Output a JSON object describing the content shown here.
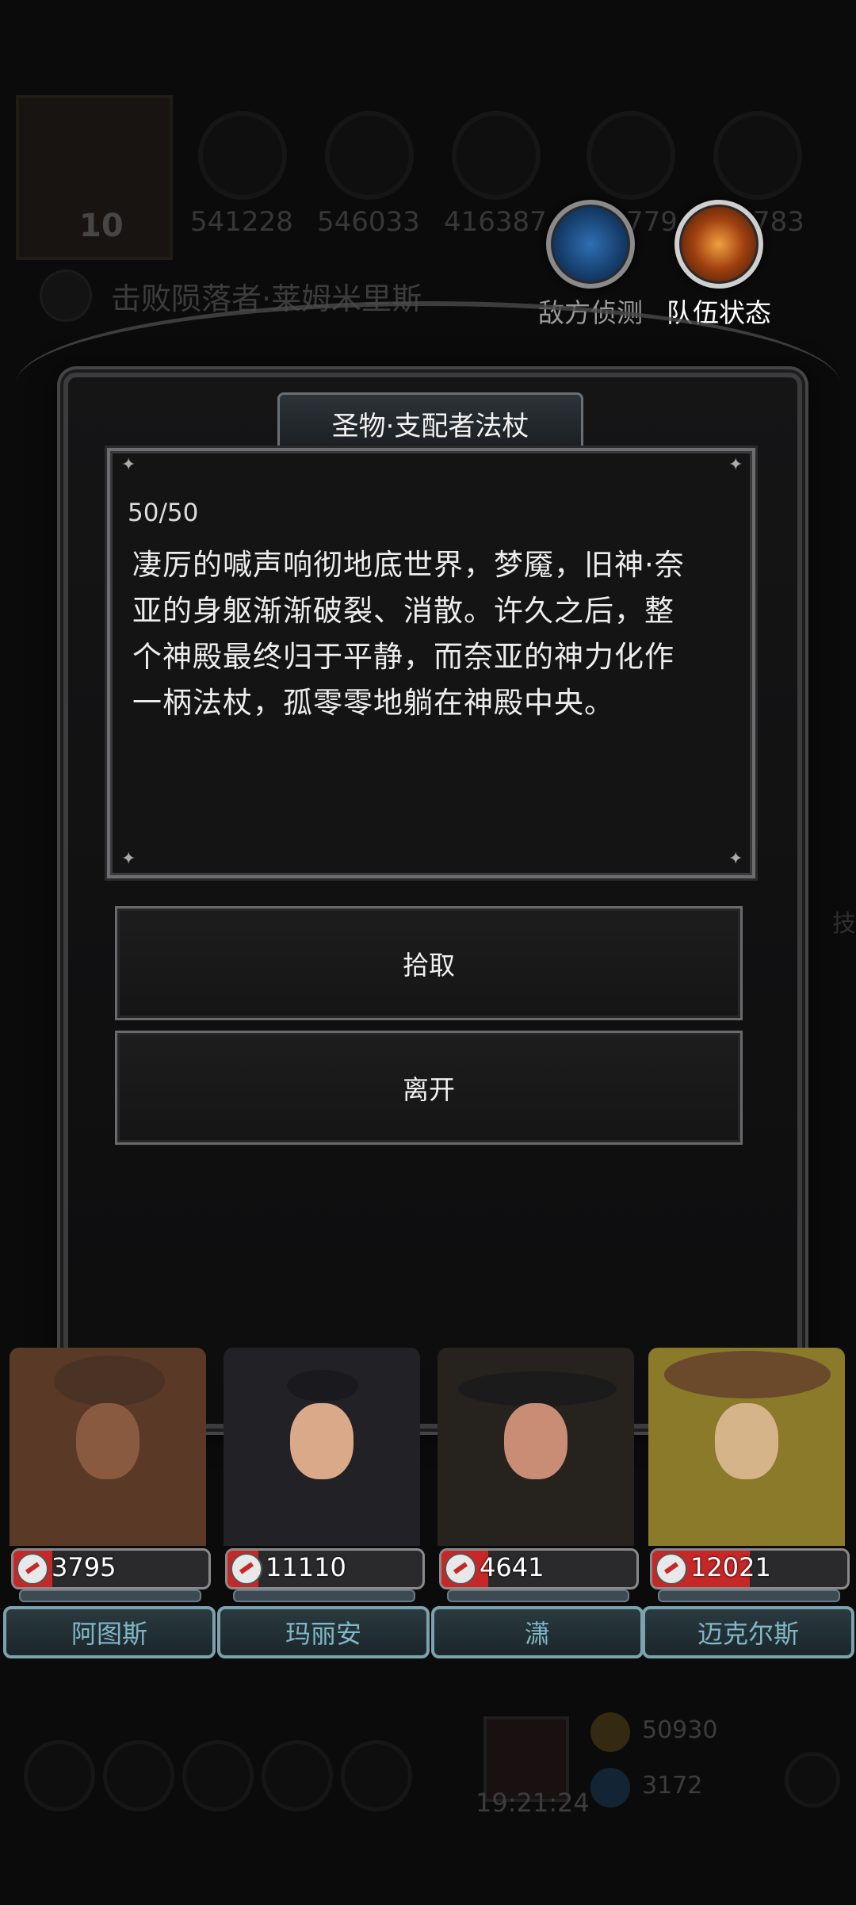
{
  "background": {
    "level": "10",
    "stats": [
      "541228",
      "546033",
      "416387",
      "779",
      "783"
    ],
    "quest": "击败陨落者·莱姆米里斯",
    "timer": "19:21:24",
    "resource_gold": "50930",
    "resource_gem": "3172",
    "side_text": "技"
  },
  "top_buttons": {
    "enemy_scan": "敌方侦测",
    "team_status": "队伍状态"
  },
  "dialog": {
    "title": "圣物·支配者法杖",
    "counter": "50/50",
    "story_lines": [
      "凄厉的喊声响彻地底世界，梦魇，旧神·奈",
      "亚的身躯渐渐破裂、消散。许久之后，整",
      "个神殿最终归于平静，而奈亚的神力化作",
      "一柄法杖，孤零零地躺在神殿中央。"
    ],
    "choice_pickup": "拾取",
    "choice_leave": "离开"
  },
  "party": [
    {
      "name": "阿图斯",
      "hp": "3795",
      "hp_fraction": 0.2,
      "colors": {
        "skin": "#8a5a40",
        "outfit": "#5a3a26",
        "hat": "#4a3224"
      }
    },
    {
      "name": "玛丽安",
      "hp": "11110",
      "hp_fraction": 0.16,
      "colors": {
        "skin": "#d9a98a",
        "outfit": "#222226",
        "hat": "#1a1a1e"
      }
    },
    {
      "name": "潇",
      "hp": "4641",
      "hp_fraction": 0.24,
      "colors": {
        "skin": "#c98d76",
        "outfit": "#26221e",
        "hat": "#1b1b1b"
      }
    },
    {
      "name": "迈克尔斯",
      "hp": "12021",
      "hp_fraction": 0.5,
      "colors": {
        "skin": "#d6b48a",
        "outfit": "#8a7a2a",
        "hat": "#6a4a2a"
      }
    }
  ]
}
